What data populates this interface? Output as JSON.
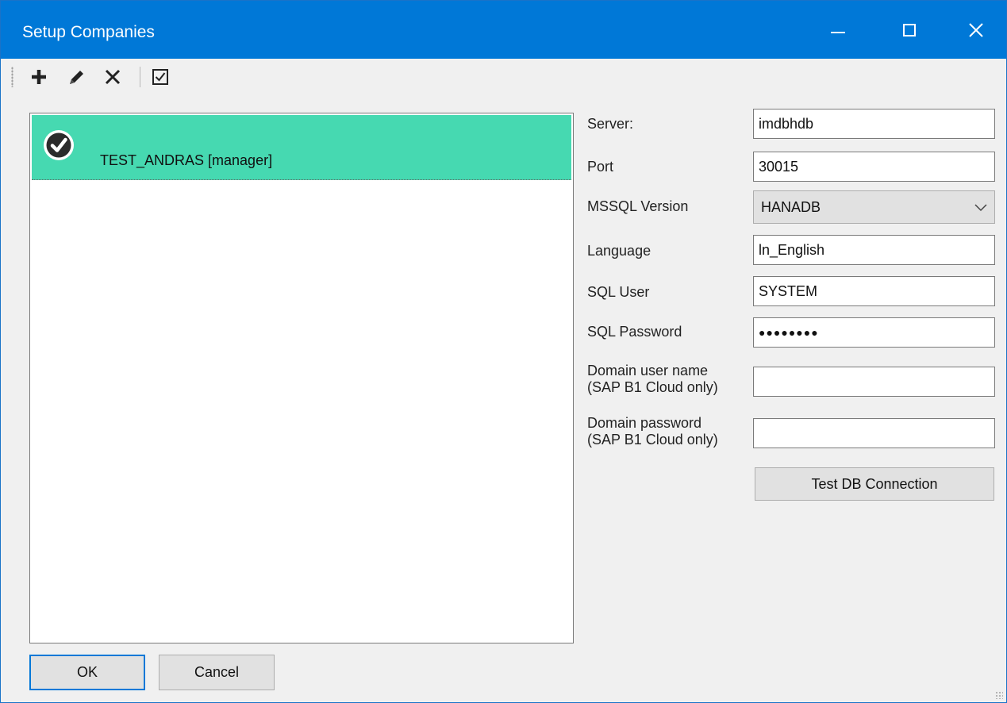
{
  "window": {
    "title": "Setup Companies",
    "controls": {
      "minimize": "minimize",
      "maximize": "maximize",
      "close": "close"
    }
  },
  "toolbar": {
    "items": [
      {
        "icon": "plus-icon"
      },
      {
        "icon": "pencil-icon"
      },
      {
        "icon": "delete-x-icon"
      },
      {
        "icon": "checkbox-icon"
      }
    ]
  },
  "companies": {
    "items": [
      {
        "label": "TEST_ANDRAS [manager]",
        "selected": true,
        "icon": "check-circle-icon",
        "highlight_color": "#46d9b1"
      }
    ]
  },
  "form": {
    "server": {
      "label": "Server:",
      "value": "imdbhdb"
    },
    "port": {
      "label": "Port",
      "value": "30015"
    },
    "mssql_version": {
      "label": "MSSQL Version",
      "value": "HANADB"
    },
    "language": {
      "label": "Language",
      "value": "ln_English"
    },
    "sql_user": {
      "label": "SQL User",
      "value": "SYSTEM"
    },
    "sql_password": {
      "label": "SQL Password",
      "value": "●●●●●●●●"
    },
    "domain_user": {
      "label_line1": "Domain user name",
      "label_line2": "(SAP B1 Cloud only)",
      "value": ""
    },
    "domain_password": {
      "label_line1": "Domain password",
      "label_line2": "(SAP B1 Cloud only)",
      "value": ""
    },
    "test_button": "Test DB Connection"
  },
  "footer": {
    "ok_label": "OK",
    "cancel_label": "Cancel"
  },
  "colors": {
    "titlebar": "#0078d7",
    "selection": "#46d9b1",
    "background": "#f0f0f0"
  }
}
